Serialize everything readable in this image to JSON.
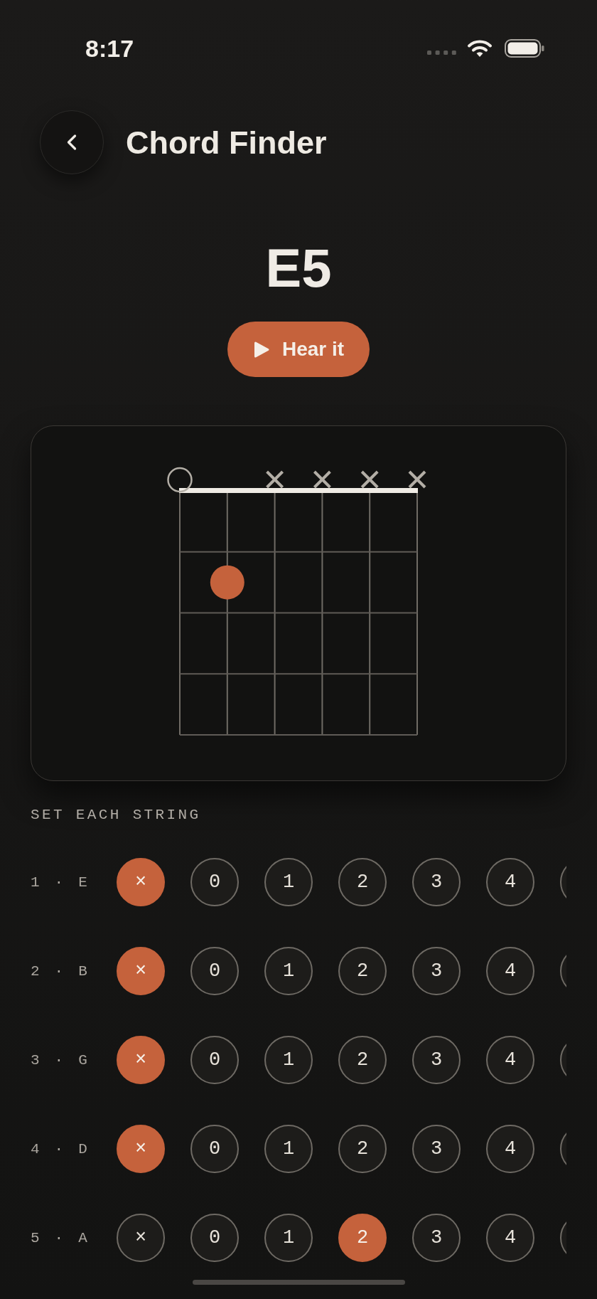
{
  "status_bar": {
    "time": "8:17"
  },
  "header": {
    "title": "Chord Finder"
  },
  "chord": {
    "name": "E5",
    "play_button": {
      "label": "Hear it"
    }
  },
  "diagram": {
    "strings": [
      {
        "kind": "open"
      },
      {
        "kind": "fret2"
      },
      {
        "kind": "muted"
      },
      {
        "kind": "muted"
      },
      {
        "kind": "muted"
      },
      {
        "kind": "muted"
      }
    ]
  },
  "string_picker": {
    "label": "SET EACH STRING",
    "rows": [
      {
        "label": "1 · E",
        "options": [
          {
            "label": "×",
            "selected": true
          },
          {
            "label": "0",
            "selected": false
          },
          {
            "label": "1",
            "selected": false
          },
          {
            "label": "2",
            "selected": false
          },
          {
            "label": "3",
            "selected": false
          },
          {
            "label": "4",
            "selected": false
          },
          {
            "selected": false
          }
        ]
      },
      {
        "label": "2 · B",
        "options": [
          {
            "label": "×",
            "selected": true
          },
          {
            "label": "0",
            "selected": false
          },
          {
            "label": "1",
            "selected": false
          },
          {
            "label": "2",
            "selected": false
          },
          {
            "label": "3",
            "selected": false
          },
          {
            "label": "4",
            "selected": false
          },
          {
            "selected": false
          }
        ]
      },
      {
        "label": "3 · G",
        "options": [
          {
            "label": "×",
            "selected": true
          },
          {
            "label": "0",
            "selected": false
          },
          {
            "label": "1",
            "selected": false
          },
          {
            "label": "2",
            "selected": false
          },
          {
            "label": "3",
            "selected": false
          },
          {
            "label": "4",
            "selected": false
          },
          {
            "selected": false
          }
        ]
      },
      {
        "label": "4 · D",
        "options": [
          {
            "label": "×",
            "selected": true
          },
          {
            "label": "0",
            "selected": false
          },
          {
            "label": "1",
            "selected": false
          },
          {
            "label": "2",
            "selected": false
          },
          {
            "label": "3",
            "selected": false
          },
          {
            "label": "4",
            "selected": false
          },
          {
            "selected": false
          }
        ]
      },
      {
        "label": "5 · A",
        "options": [
          {
            "label": "×",
            "selected": false
          },
          {
            "label": "0",
            "selected": false
          },
          {
            "label": "1",
            "selected": false
          },
          {
            "label": "2",
            "selected": true
          },
          {
            "label": "3",
            "selected": false
          },
          {
            "label": "4",
            "selected": false
          },
          {
            "selected": false
          }
        ]
      }
    ]
  }
}
